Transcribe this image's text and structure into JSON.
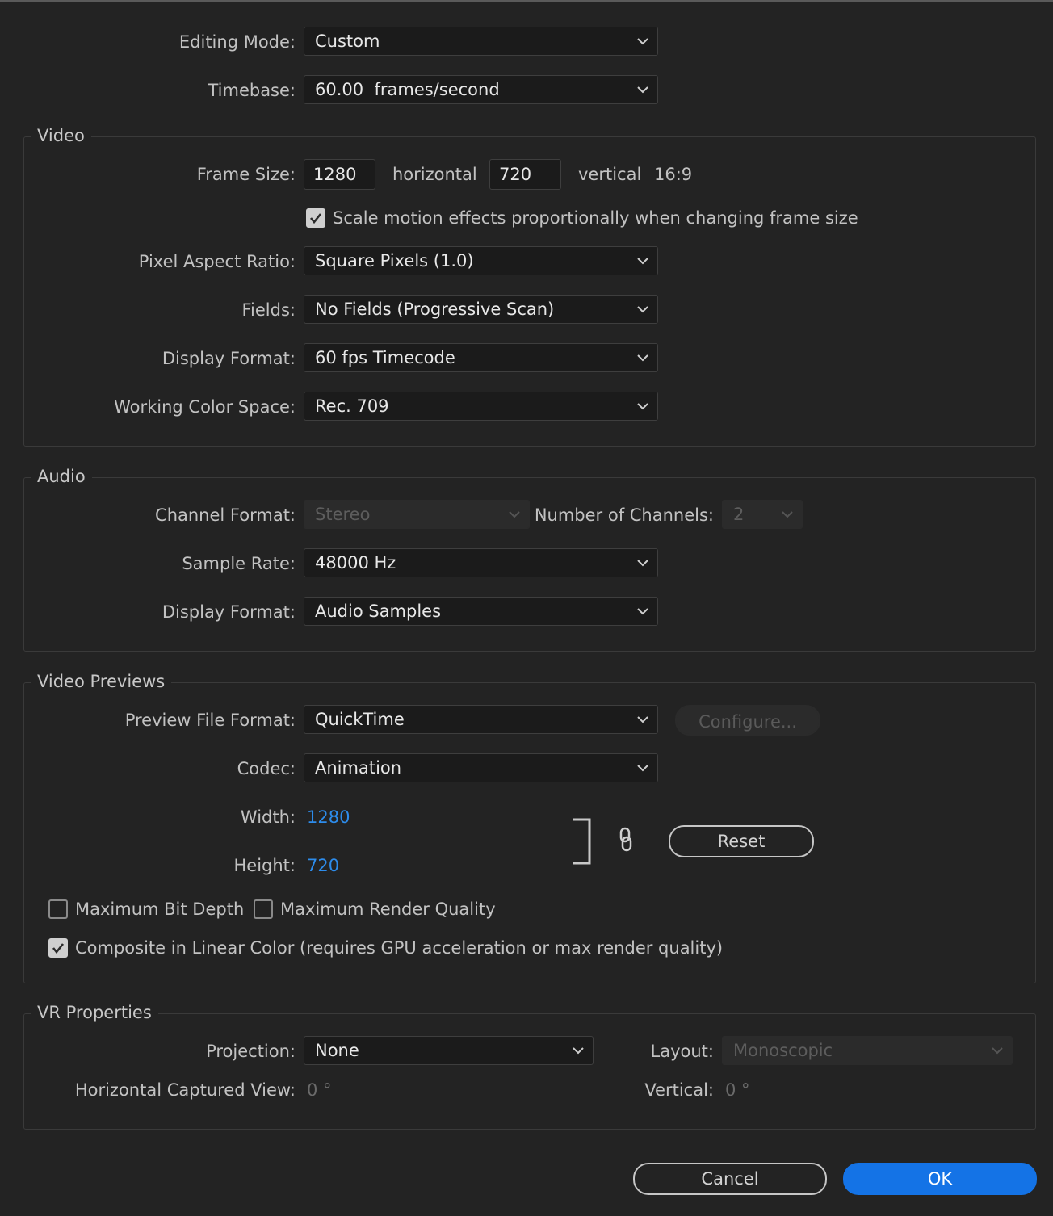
{
  "general": {
    "editing_mode_label": "Editing Mode:",
    "editing_mode_value": "Custom",
    "timebase_label": "Timebase:",
    "timebase_value": "60.00  frames/second"
  },
  "video": {
    "title": "Video",
    "frame_size_label": "Frame Size:",
    "frame_width": "1280",
    "horizontal_label": "horizontal",
    "frame_height": "720",
    "vertical_label": "vertical",
    "aspect": "16:9",
    "scale_motion_label": "Scale motion effects proportionally when changing frame size",
    "scale_motion_checked": true,
    "pixel_aspect_label": "Pixel Aspect Ratio:",
    "pixel_aspect_value": "Square Pixels (1.0)",
    "fields_label": "Fields:",
    "fields_value": "No Fields (Progressive Scan)",
    "display_format_label": "Display Format:",
    "display_format_value": "60 fps Timecode",
    "color_space_label": "Working Color Space:",
    "color_space_value": "Rec. 709"
  },
  "audio": {
    "title": "Audio",
    "channel_format_label": "Channel Format:",
    "channel_format_value": "Stereo",
    "num_channels_label": "Number of Channels:",
    "num_channels_value": "2",
    "sample_rate_label": "Sample Rate:",
    "sample_rate_value": "48000 Hz",
    "display_format_label": "Display Format:",
    "display_format_value": "Audio Samples"
  },
  "previews": {
    "title": "Video Previews",
    "file_format_label": "Preview File Format:",
    "file_format_value": "QuickTime",
    "configure_label": "Configure...",
    "codec_label": "Codec:",
    "codec_value": "Animation",
    "width_label": "Width:",
    "width_value": "1280",
    "height_label": "Height:",
    "height_value": "720",
    "reset_label": "Reset",
    "max_bit_depth_label": "Maximum Bit Depth",
    "max_bit_depth_checked": false,
    "max_render_quality_label": "Maximum Render Quality",
    "max_render_quality_checked": false,
    "linear_color_label": "Composite in Linear Color (requires GPU acceleration or max render quality)",
    "linear_color_checked": true
  },
  "vr": {
    "title": "VR Properties",
    "projection_label": "Projection:",
    "projection_value": "None",
    "layout_label": "Layout:",
    "layout_value": "Monoscopic",
    "h_captured_label": "Horizontal Captured View:",
    "h_captured_value": "0 °",
    "vertical_label": "Vertical:",
    "vertical_value": "0 °"
  },
  "footer": {
    "cancel_label": "Cancel",
    "ok_label": "OK"
  },
  "colors": {
    "background": "#232323",
    "accent": "#1473e6",
    "link": "#2d8ceb"
  },
  "icons": {
    "dropdown": "chevron-down-icon",
    "check": "checkmark-icon",
    "link": "link-chain-icon",
    "bracket": "bracket-icon"
  }
}
